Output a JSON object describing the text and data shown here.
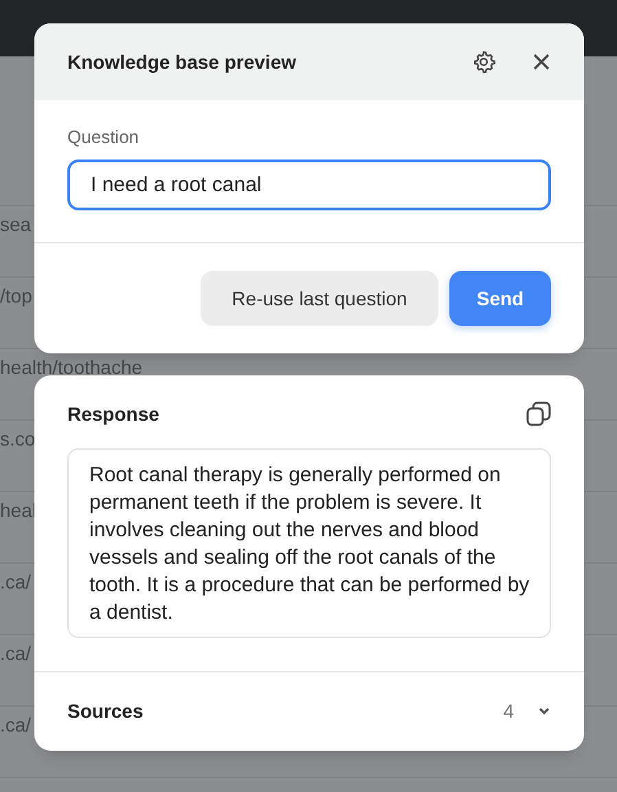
{
  "background_rows": [
    {
      "text": "sea"
    },
    {
      "text": "/top"
    },
    {
      "text": "health/toothache"
    },
    {
      "text": "s.co"
    },
    {
      "text": "heal"
    },
    {
      "text": ".ca/"
    },
    {
      "text": ".ca/"
    },
    {
      "text": ".ca/"
    }
  ],
  "preview_dialog": {
    "title": "Knowledge base preview",
    "question_label": "Question",
    "question_value": "I need a root canal",
    "focused": true,
    "buttons": [
      {
        "label": "Re-use last question",
        "kind": "secondary"
      },
      {
        "label": "Send",
        "kind": "primary"
      }
    ]
  },
  "response_panel": {
    "title": "Response",
    "text": "Root canal therapy is generally performed on permanent teeth if the problem is severe. It involves cleaning out the nerves and blood vessels and sealing off the root canals of the tooth. It is a procedure that can be performed by a dentist.",
    "sources_label": "Sources",
    "sources_count": "4",
    "expanded": false
  }
}
